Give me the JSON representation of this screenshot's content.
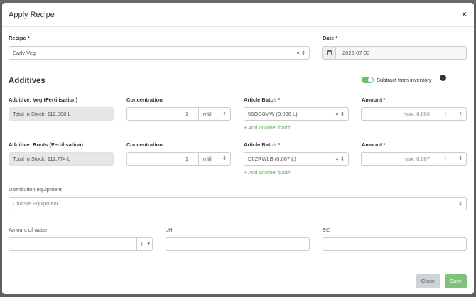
{
  "modal": {
    "title": "Apply Recipe",
    "close_glyph": "×"
  },
  "recipe": {
    "label": "Recipe",
    "value": "Early Veg",
    "clear_glyph": "×",
    "arrows_glyph": "⇕"
  },
  "date": {
    "label": "Date",
    "value": "2025-07-03",
    "icon": "calendar-icon"
  },
  "additives": {
    "title": "Additives",
    "subtract_toggle": {
      "label": "Subtract from inventory",
      "on": true,
      "info_glyph": "i"
    },
    "rows": [
      {
        "label": "Additive: Veg (Fertilisation)",
        "stock": "Total in Stock: 112.888 L",
        "concentration_label": "Concentration",
        "concentration": "1",
        "concentration_unit": "ml/l",
        "batch_label": "Article Batch",
        "batch": "56QG8MW (0.006 L)",
        "add_batch": "+ Add another batch",
        "amount_label": "Amount",
        "amount_placeholder": "max. 0.006",
        "amount_unit": "l"
      },
      {
        "label": "Additive: Roots (Fertilisation)",
        "stock": "Total in Stock: 111.774 L",
        "concentration_label": "Concentration",
        "concentration": "1",
        "concentration_unit": "ml/l",
        "batch_label": "Article Batch",
        "batch": "D6ZRWLB (0.087 L)",
        "add_batch": "+ Add another batch",
        "amount_label": "Amount",
        "amount_placeholder": "max. 0.087",
        "amount_unit": "l"
      }
    ]
  },
  "distribution": {
    "label": "Distribution equipment",
    "placeholder": "Choose Equipment"
  },
  "water": {
    "label": "Amount of water",
    "value": "",
    "unit": "l"
  },
  "ph": {
    "label": "pH",
    "value": ""
  },
  "ec": {
    "label": "EC",
    "value": ""
  },
  "footer": {
    "close_label": "Close",
    "save_label": "Save"
  },
  "colors": {
    "accent_green": "#6aaa64",
    "save_button": "#7fc27a",
    "close_button": "#cfd3d6"
  }
}
